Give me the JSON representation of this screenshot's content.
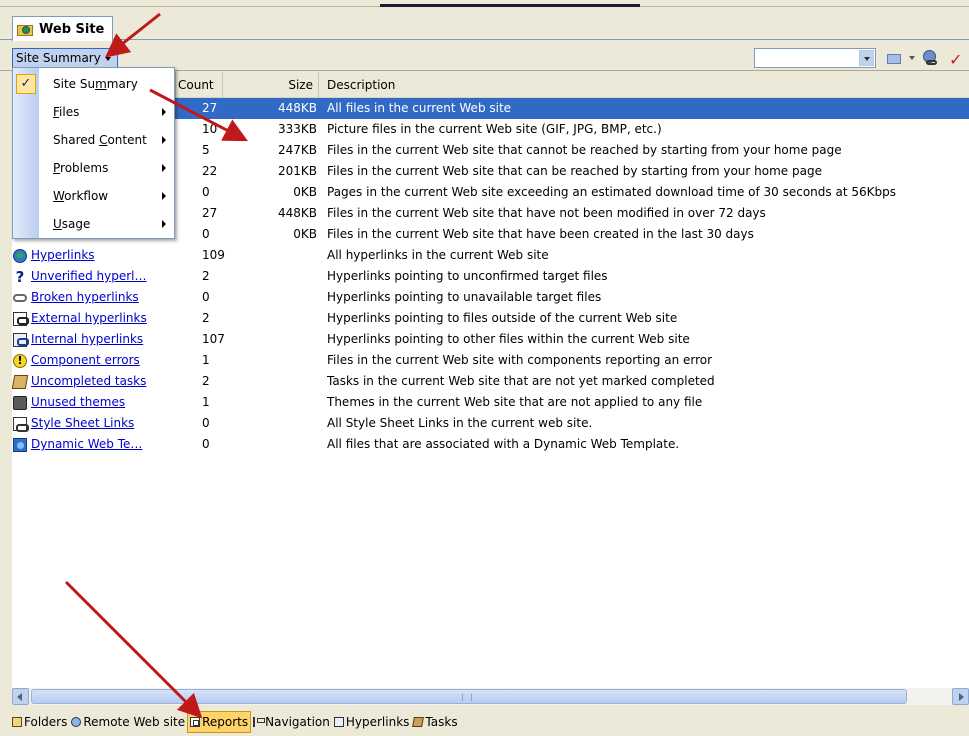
{
  "tab": {
    "title": "Web Site"
  },
  "report_dropdown": {
    "label": "Site Summary"
  },
  "columns": {
    "count": "Count",
    "size": "Size",
    "description": "Description"
  },
  "rows": [
    {
      "name": "",
      "count": "27",
      "size": "448KB",
      "description": "All files in the current Web site",
      "selected": true
    },
    {
      "name": "",
      "count": "10",
      "size": "333KB",
      "description": "Picture files in the current Web site (GIF, JPG, BMP, etc.)"
    },
    {
      "name": "",
      "count": "5",
      "size": "247KB",
      "description": "Files in the current Web site that cannot be reached by starting from your home page"
    },
    {
      "name": "",
      "count": "22",
      "size": "201KB",
      "description": "Files in the current Web site that can be reached by starting from your home page"
    },
    {
      "name": "",
      "count": "0",
      "size": "0KB",
      "description": "Pages in the current Web site exceeding an estimated download time of 30 seconds at 56Kbps"
    },
    {
      "name": "",
      "count": "27",
      "size": "448KB",
      "description": "Files in the current Web site that have not been modified in over 72 days"
    },
    {
      "name": "",
      "count": "0",
      "size": "0KB",
      "description": "Files in the current Web site that have been created in the last 30 days"
    },
    {
      "name": "Hyperlinks",
      "icon": "globe-chain-icon",
      "count": "109",
      "size": "",
      "description": "All hyperlinks in the current Web site"
    },
    {
      "name": "Unverified hyperl…",
      "icon": "question-mark-icon",
      "count": "2",
      "size": "",
      "description": "Hyperlinks pointing to unconfirmed target files"
    },
    {
      "name": "Broken hyperlinks",
      "icon": "broken-chain-icon",
      "count": "0",
      "size": "",
      "description": "Hyperlinks pointing to unavailable target files"
    },
    {
      "name": "External hyperlinks",
      "icon": "external-link-icon",
      "count": "2",
      "size": "",
      "description": "Hyperlinks pointing to files outside of the current Web site"
    },
    {
      "name": "Internal hyperlinks",
      "icon": "internal-link-icon",
      "count": "107",
      "size": "",
      "description": "Hyperlinks pointing to other files within the current Web site"
    },
    {
      "name": "Component errors",
      "icon": "warning-icon",
      "count": "1",
      "size": "",
      "description": "Files in the current Web site with components reporting an error"
    },
    {
      "name": "Uncompleted tasks",
      "icon": "task-icon",
      "count": "2",
      "size": "",
      "description": "Tasks in the current Web site that are not yet marked completed"
    },
    {
      "name": "Unused themes",
      "icon": "theme-icon",
      "count": "1",
      "size": "",
      "description": "Themes in the current Web site that are not applied to any file"
    },
    {
      "name": "Style Sheet Links",
      "icon": "style-sheet-icon",
      "count": "0",
      "size": "",
      "description": "All Style Sheet Links in the current web site."
    },
    {
      "name": "Dynamic Web Te…",
      "icon": "dynamic-template-icon",
      "count": "0",
      "size": "",
      "description": "All files that are associated with a Dynamic Web Template."
    }
  ],
  "menu": {
    "items": [
      {
        "pre": "Site Su",
        "u": "m",
        "post": "mary",
        "checked": true,
        "submenu": false
      },
      {
        "pre": "",
        "u": "F",
        "post": "iles",
        "submenu": true
      },
      {
        "pre": "Shared ",
        "u": "C",
        "post": "ontent",
        "submenu": true
      },
      {
        "pre": "",
        "u": "P",
        "post": "roblems",
        "submenu": true
      },
      {
        "pre": "",
        "u": "W",
        "post": "orkflow",
        "submenu": true
      },
      {
        "pre": "",
        "u": "U",
        "post": "sage",
        "submenu": true
      }
    ]
  },
  "views": [
    {
      "label": "Folders",
      "icon": "folder-icon",
      "active": false
    },
    {
      "label": "Remote Web site",
      "icon": "remote-site-icon",
      "active": false
    },
    {
      "label": "Reports",
      "icon": "reports-icon",
      "active": true
    },
    {
      "label": "Navigation",
      "icon": "navigation-icon",
      "active": false
    },
    {
      "label": "Hyperlinks",
      "icon": "hyperlinks-icon",
      "active": false
    },
    {
      "label": "Tasks",
      "icon": "tasks-icon",
      "active": false
    }
  ],
  "colors": {
    "selection": "#316ac5",
    "annotation_arrow": "#c0191a",
    "active_view": "#ffd36a"
  }
}
